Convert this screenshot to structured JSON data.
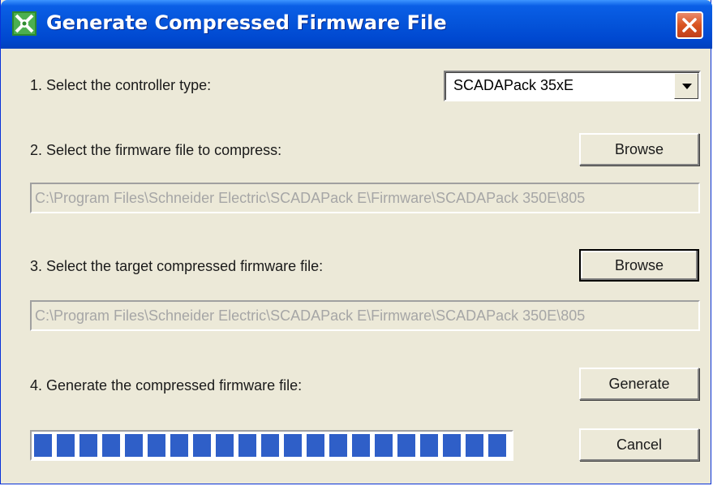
{
  "window": {
    "title": "Generate Compressed Firmware File",
    "accent_color": "#0453d9",
    "icon": "firmware-app-icon"
  },
  "steps": {
    "controller": {
      "label": "1. Select the controller type:",
      "selected": "SCADAPack 35xE"
    },
    "firmware": {
      "label": "2. Select the firmware file to compress:",
      "browse_label": "Browse",
      "path": "C:\\Program Files\\Schneider Electric\\SCADAPack E\\Firmware\\SCADAPack 350E\\805"
    },
    "target": {
      "label": "3. Select the target compressed firmware file:",
      "browse_label": "Browse",
      "path": "C:\\Program Files\\Schneider Electric\\SCADAPack E\\Firmware\\SCADAPack 350E\\805"
    },
    "generate": {
      "label": "4. Generate the compressed firmware file:",
      "button_label": "Generate"
    }
  },
  "progress": {
    "fraction": 1.0,
    "segment_color": "#2f5fc8"
  },
  "cancel_label": "Cancel"
}
